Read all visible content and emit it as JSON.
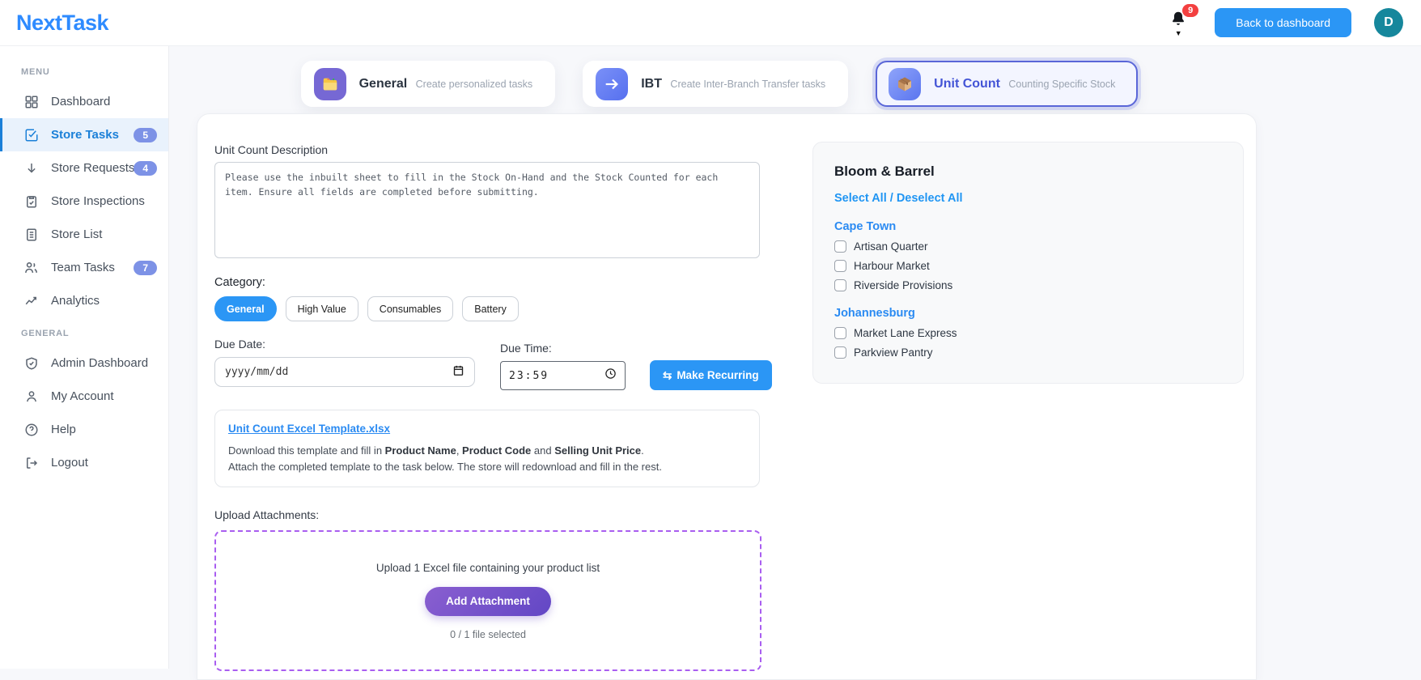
{
  "brand": {
    "logo": "NextTask"
  },
  "topbar": {
    "notification_count": "9",
    "back_button_label": "Back to dashboard",
    "avatar_initial": "D"
  },
  "sidebar": {
    "menu_header": "MENU",
    "general_header": "GENERAL",
    "items": [
      {
        "label": "Dashboard",
        "icon": "grid-icon",
        "badge": ""
      },
      {
        "label": "Store Tasks",
        "icon": "check-square-icon",
        "badge": "5",
        "active": true
      },
      {
        "label": "Store Requests",
        "icon": "arrow-down-icon",
        "badge": "4"
      },
      {
        "label": "Store Inspections",
        "icon": "clipboard-icon",
        "badge": ""
      },
      {
        "label": "Store List",
        "icon": "document-icon",
        "badge": ""
      },
      {
        "label": "Team Tasks",
        "icon": "people-icon",
        "badge": "7"
      },
      {
        "label": "Analytics",
        "icon": "trend-icon",
        "badge": ""
      }
    ],
    "general_items": [
      {
        "label": "Admin Dashboard",
        "icon": "shield-icon"
      },
      {
        "label": "My Account",
        "icon": "person-icon"
      },
      {
        "label": "Help",
        "icon": "question-icon"
      },
      {
        "label": "Logout",
        "icon": "logout-icon"
      }
    ]
  },
  "tabs": [
    {
      "label": "General",
      "description": "Create personalized tasks",
      "icon": "folder-icon",
      "selected": false
    },
    {
      "label": "IBT",
      "description": "Create Inter-Branch Transfer tasks",
      "icon": "arrow-right-icon",
      "selected": false
    },
    {
      "label": "Unit Count",
      "description": "Counting Specific Stock",
      "icon": "package-icon",
      "selected": true
    }
  ],
  "form": {
    "description_label": "Unit Count Description",
    "description_value": "Please use the inbuilt sheet to fill in the Stock On-Hand and the Stock Counted for each item. Ensure all fields are completed before submitting.",
    "category_label": "Category:",
    "categories": [
      {
        "label": "General",
        "selected": true
      },
      {
        "label": "High Value",
        "selected": false
      },
      {
        "label": "Consumables",
        "selected": false
      },
      {
        "label": "Battery",
        "selected": false
      }
    ],
    "due_date_label": "Due Date:",
    "due_date_placeholder": "yyyy/mm/dd",
    "due_time_label": "Due Time:",
    "due_time_value": "23:59",
    "recurring_icon": "⇆",
    "make_recurring_label": "Make Recurring",
    "template": {
      "link_label": "Unit Count Excel Template.xlsx",
      "line1_prefix": "Download this template and fill in ",
      "bold1": "Product Name",
      "sep1": ", ",
      "bold2": "Product Code",
      "sep2": " and ",
      "bold3": "Selling Unit Price",
      "line1_suffix": ".",
      "line2": "Attach the completed template to the task below. The store will redownload and fill in the rest."
    },
    "upload": {
      "label": "Upload Attachments:",
      "instruction": "Upload 1 Excel file containing your product list",
      "button_label": "Add Attachment",
      "status": "0 / 1 file selected"
    }
  },
  "store_selector": {
    "company": "Bloom & Barrel",
    "select_all_label": "Select All / Deselect All",
    "groups": [
      {
        "city": "Cape Town",
        "stores": [
          {
            "name": "Artisan Quarter",
            "checked": false
          },
          {
            "name": "Harbour Market",
            "checked": false
          },
          {
            "name": "Riverside Provisions",
            "checked": false
          }
        ]
      },
      {
        "city": "Johannesburg",
        "stores": [
          {
            "name": "Market Lane Express",
            "checked": false
          },
          {
            "name": "Parkview Pantry",
            "checked": false
          }
        ]
      }
    ]
  },
  "colors": {
    "primary_blue": "#2b96f5",
    "logo_blue": "#2e8bff",
    "active_sidebar_blue": "#1b80d8",
    "badge_periwinkle": "#7d92e6",
    "notification_red": "#f34040",
    "avatar_teal": "#16879c",
    "selected_tab_indigo": "#5a66d8",
    "upload_purple": "#a95ef0",
    "attach_gradient_start": "#8a5fd0",
    "attach_gradient_end": "#6247c5"
  }
}
